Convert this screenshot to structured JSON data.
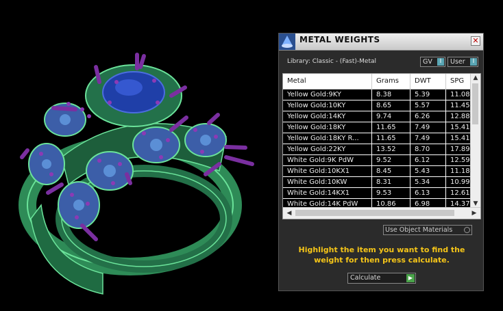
{
  "window": {
    "title": "METAL WEIGHTS",
    "close_glyph": "✕",
    "icon": "app-icon"
  },
  "library_label": "Library: Classic - (Fast)-Metal",
  "toggles": {
    "gv": "GV",
    "user": "User",
    "indicator": "I"
  },
  "table": {
    "columns": [
      "Metal",
      "Grams",
      "DWT",
      "SPG"
    ],
    "rows": [
      {
        "metal": "Yellow Gold:9KY",
        "grams": "8.38",
        "dwt": "5.39",
        "spg": "11.08"
      },
      {
        "metal": "Yellow Gold:10KY",
        "grams": "8.65",
        "dwt": "5.57",
        "spg": "11.45"
      },
      {
        "metal": "Yellow Gold:14KY",
        "grams": "9.74",
        "dwt": "6.26",
        "spg": "12.88"
      },
      {
        "metal": "Yellow Gold:18KY",
        "grams": "11.65",
        "dwt": "7.49",
        "spg": "15.41"
      },
      {
        "metal": "Yellow Gold:18KY R...",
        "grams": "11.65",
        "dwt": "7.49",
        "spg": "15.41"
      },
      {
        "metal": "Yellow Gold:22KY",
        "grams": "13.52",
        "dwt": "8.70",
        "spg": "17.89"
      },
      {
        "metal": "White Gold:9K PdW",
        "grams": "9.52",
        "dwt": "6.12",
        "spg": "12.59"
      },
      {
        "metal": "White Gold:10KX1",
        "grams": "8.45",
        "dwt": "5.43",
        "spg": "11.18"
      },
      {
        "metal": "White Gold:10KW",
        "grams": "8.31",
        "dwt": "5.34",
        "spg": "10.99"
      },
      {
        "metal": "White Gold:14KX1",
        "grams": "9.53",
        "dwt": "6.13",
        "spg": "12.61"
      },
      {
        "metal": "White Gold:14K PdW",
        "grams": "10.86",
        "dwt": "6.98",
        "spg": "14.37"
      }
    ]
  },
  "scroll_arrows": {
    "up": "▲",
    "down": "▼",
    "left": "◀",
    "right": "▶"
  },
  "use_object_materials": "Use Object Materials",
  "instruction": "Highlight the item you want to find the weight for then press calculate.",
  "calculate_label": "Calculate",
  "calculate_glyph": "▶",
  "colors": {
    "panel_bg": "#2b2b2b",
    "instruction": "#f5c518",
    "ring_metal": "#2e8b57",
    "center_stone": "#1f3fa8",
    "accent_stones": "#5b8fd6",
    "prongs": "#7a2fa0"
  },
  "viewport": {
    "content": "3D jewelry ring model",
    "icons": [
      "ring-model"
    ]
  }
}
